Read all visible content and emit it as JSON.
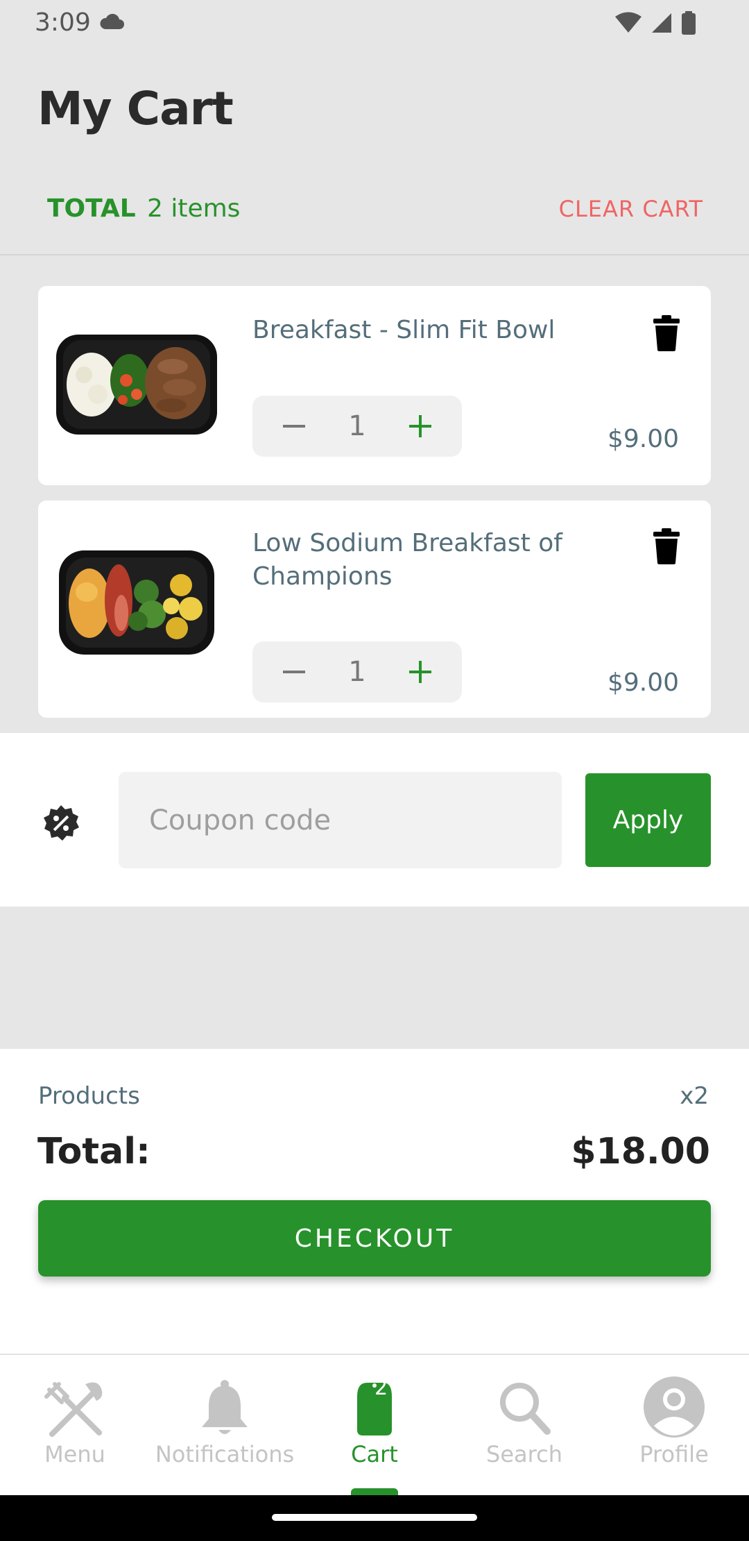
{
  "status_bar": {
    "time": "3:09"
  },
  "header": {
    "title": "My Cart"
  },
  "summary_bar": {
    "total_label": "TOTAL",
    "item_count": "2 items",
    "clear_label": "CLEAR CART"
  },
  "cart": {
    "items": [
      {
        "name": "Breakfast - Slim Fit Bowl",
        "quantity": "1",
        "price": "$9.00"
      },
      {
        "name": "Low Sodium Breakfast of Champions",
        "quantity": "1",
        "price": "$9.00"
      }
    ]
  },
  "coupon": {
    "placeholder": "Coupon code",
    "apply_label": "Apply"
  },
  "totals": {
    "products_label": "Products",
    "products_count": "x2",
    "total_label": "Total:",
    "total_amount": "$18.00",
    "checkout_label": "CHECKOUT"
  },
  "nav": {
    "items": [
      {
        "label": "Menu",
        "icon": "utensils-icon"
      },
      {
        "label": "Notifications",
        "icon": "bell-icon"
      },
      {
        "label": "Cart",
        "icon": "shopping-bag-icon",
        "badge": "2"
      },
      {
        "label": "Search",
        "icon": "search-icon"
      },
      {
        "label": "Profile",
        "icon": "account-icon"
      }
    ]
  },
  "colors": {
    "accent": "#27922b",
    "danger": "#f06464",
    "text": "#546e7a",
    "background": "#e6e6e6"
  }
}
